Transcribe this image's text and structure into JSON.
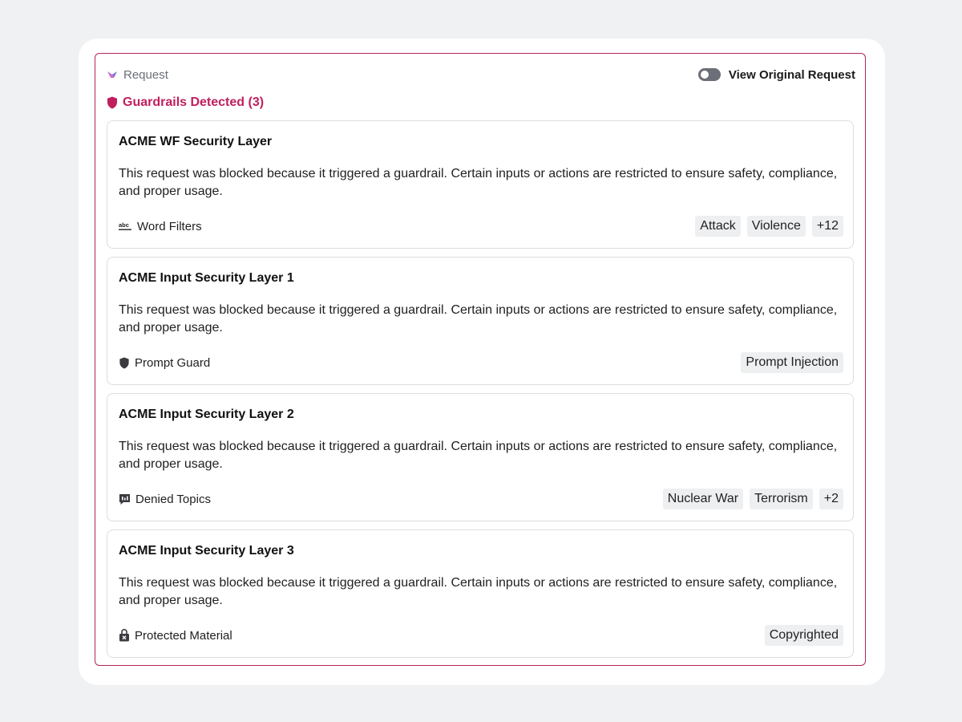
{
  "header": {
    "request_label": "Request",
    "toggle_label": "View Original Request",
    "toggle_on": false
  },
  "guardrails": {
    "title": "Guardrails Detected (3)"
  },
  "cards": [
    {
      "title": "ACME WF Security Layer",
      "description": "This request was blocked because it triggered a guardrail. Certain inputs or actions are restricted to ensure safety, compliance, and proper usage.",
      "category": "Word Filters",
      "icon": "abc-icon",
      "tags": [
        "Attack",
        "Violence",
        "+12"
      ]
    },
    {
      "title": "ACME Input Security Layer 1",
      "description": "This request was blocked because it triggered a guardrail. Certain inputs or actions are restricted to ensure safety, compliance, and proper usage.",
      "category": "Prompt Guard",
      "icon": "shield-icon",
      "tags": [
        "Prompt Injection"
      ]
    },
    {
      "title": "ACME Input Security Layer 2",
      "description": "This request was blocked because it triggered a guardrail. Certain inputs or actions are restricted to ensure safety, compliance, and proper usage.",
      "category": "Denied Topics",
      "icon": "chat-block-icon",
      "tags": [
        "Nuclear War",
        "Terrorism",
        "+2"
      ]
    },
    {
      "title": "ACME Input Security Layer 3",
      "description": "This request was blocked because it triggered a guardrail. Certain inputs or actions are restricted to ensure safety, compliance, and proper usage.",
      "category": "Protected Material",
      "icon": "lock-x-icon",
      "tags": [
        "Copyrighted"
      ]
    }
  ],
  "colors": {
    "accent": "#c01f5e",
    "border_accent": "#b3245c",
    "tag_bg": "#eeeff1"
  }
}
